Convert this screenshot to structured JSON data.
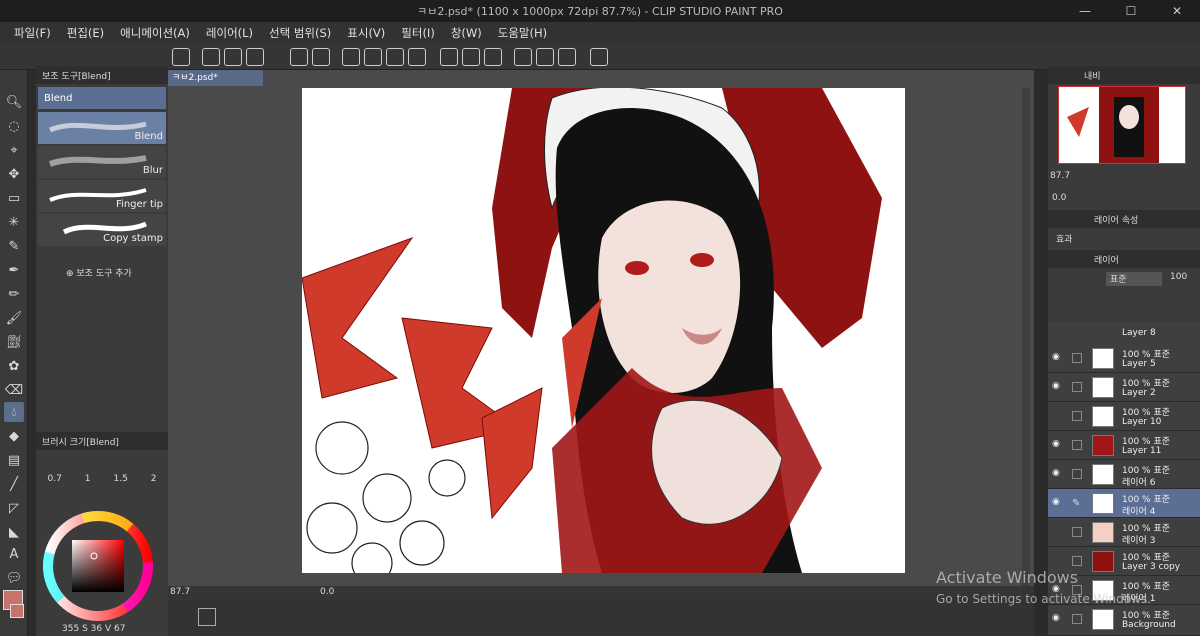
{
  "window": {
    "title": "ㅋㅂ2.psd* (1100 x 1000px 72dpi 87.7%) - CLIP STUDIO PAINT PRO",
    "min": "—",
    "max": "☐",
    "close": "✕"
  },
  "menu": [
    "파일(F)",
    "편집(E)",
    "애니메이션(A)",
    "레이어(L)",
    "선택 범위(S)",
    "표시(V)",
    "필터(I)",
    "창(W)",
    "도움말(H)"
  ],
  "subtool": {
    "header": "보조 도구[Blend]",
    "selected": "Blend",
    "brushes": [
      "Blend",
      "Blur",
      "Finger tip",
      "Copy stamp"
    ],
    "add": "보조 도구 추가"
  },
  "brushsize": {
    "header": "브러시 크기[Blend]",
    "values": [
      "0.7",
      "1",
      "1.5",
      "2"
    ]
  },
  "doc": {
    "tab": "ㅋㅂ2.psd*",
    "zoom": "87.7",
    "angle": "0.0"
  },
  "navigator": {
    "tab": "내비",
    "zoom": "87.7",
    "angle": "0.0"
  },
  "layerprops": {
    "tab": "레이어 속성",
    "effect": "효과"
  },
  "layerpanel": {
    "tab": "레이어",
    "blend": "표준",
    "opacity": "100"
  },
  "layers": [
    {
      "pct": "Layer 8",
      "name": ""
    },
    {
      "pct": "100 % 표준",
      "name": "Layer 5"
    },
    {
      "pct": "100 % 표준",
      "name": "Layer 2"
    },
    {
      "pct": "100 % 표준",
      "name": "Layer 10"
    },
    {
      "pct": "100 % 표준",
      "name": "Layer 11"
    },
    {
      "pct": "100 % 표준",
      "name": "레이어 6"
    },
    {
      "pct": "100 % 표준",
      "name": "레이어 4"
    },
    {
      "pct": "100 % 표준",
      "name": "레이어 3"
    },
    {
      "pct": "100 % 표준",
      "name": "Layer 3 copy"
    },
    {
      "pct": "100 % 표준",
      "name": "레이어 1"
    },
    {
      "pct": "100 % 표준",
      "name": "Background"
    }
  ],
  "color": {
    "s": "355",
    "v": "36",
    "x": "67",
    "S_label": "S",
    "V_label": "V"
  },
  "watermark": {
    "line1": "Activate Windows",
    "line2": "Go to Settings to activate Windows."
  },
  "colors": {
    "accent": "#5a6f93",
    "red": "#8e1212"
  }
}
